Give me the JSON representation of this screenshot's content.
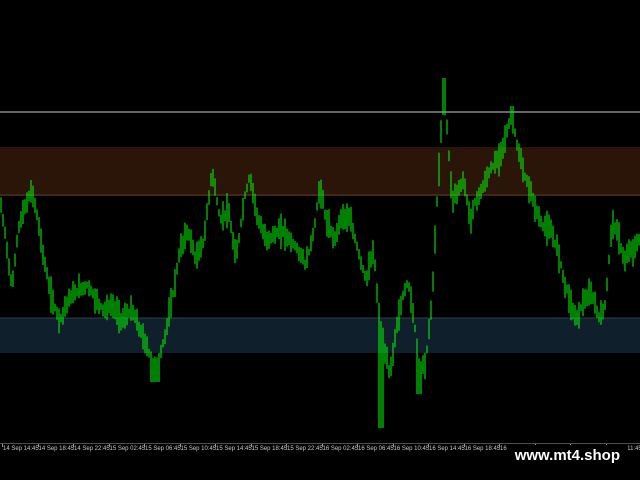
{
  "chart": {
    "symbol_color_up": "#00ff00",
    "background": "#000000",
    "supply_zone_color": "#2b1408",
    "demand_zone_color": "#0f1f2c",
    "level_line_color": "#c8c8c8"
  },
  "time_axis": {
    "labels": [
      "14 Sep 14:45",
      "14 Sep 18:45",
      "14 Sep 22:45",
      "15 Sep 02:45",
      "15 Sep 06:45",
      "15 Sep 10:45",
      "15 Sep 14:45",
      "15 Sep 18:45",
      "15 Sep 22:45",
      "16 Sep 02:45",
      "16 Sep 06:45",
      "16 Sep 10:45",
      "16 Sep 14:45",
      "16 Sep 18:45",
      "16 Sep 22:45",
      "17 Sep 02:45",
      "17 Sep 06:45",
      "17 Sep 11:45"
    ]
  },
  "watermark": {
    "text": "www.mt4.shop"
  }
}
